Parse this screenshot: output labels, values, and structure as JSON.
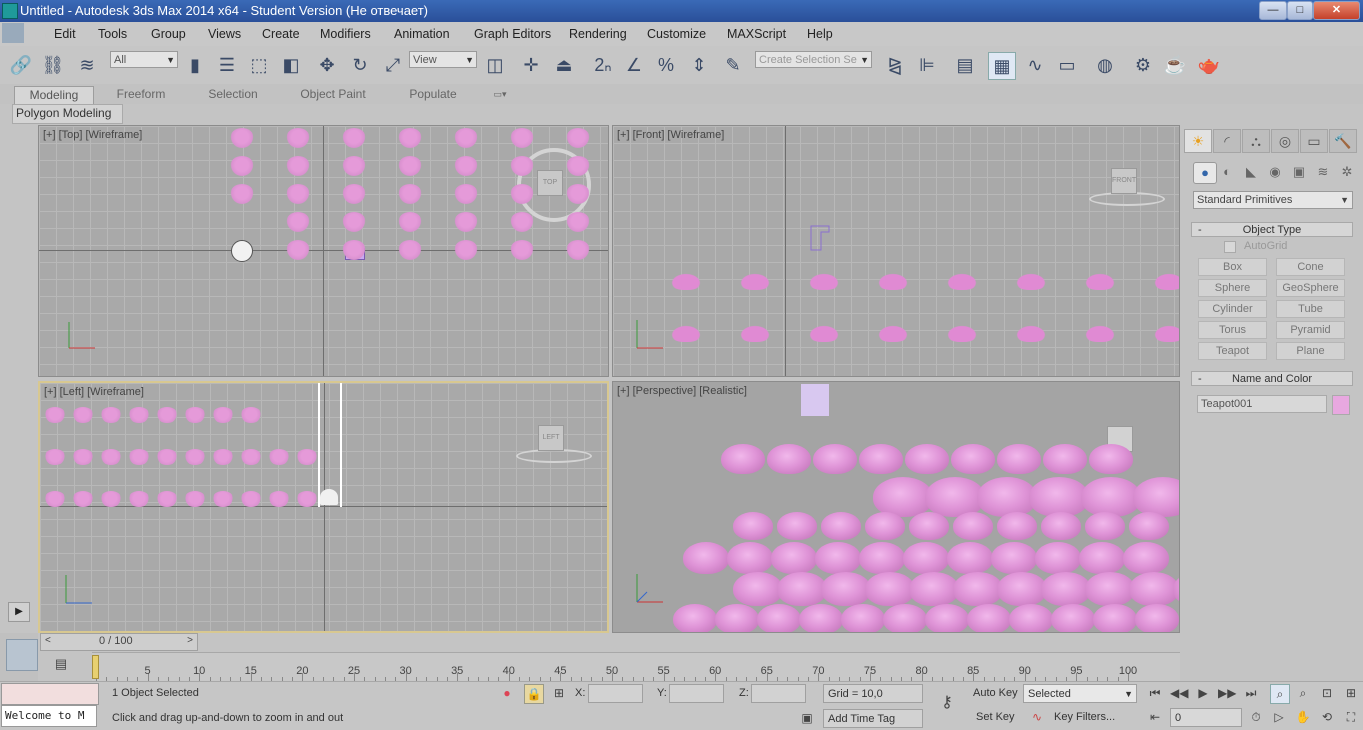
{
  "window": {
    "title": "Untitled - Autodesk 3ds Max  2014 x64  - Student Version (Не отвечает)",
    "controls": {
      "minimize": "—",
      "maximize": "□",
      "close": "✕"
    }
  },
  "menu": [
    "Edit",
    "Tools",
    "Group",
    "Views",
    "Create",
    "Modifiers",
    "Animation",
    "Graph Editors",
    "Rendering",
    "Customize",
    "MAXScript",
    "Help"
  ],
  "toolbar": {
    "filter_value": "All",
    "ref_coord_value": "View",
    "selection_set_placeholder": "Create Selection Se",
    "icons": [
      "link-icon",
      "unlink-icon",
      "bind-spacewarp-icon",
      "select-object-icon",
      "select-by-name-icon",
      "rect-selection-icon",
      "window-crossing-icon",
      "move-icon",
      "rotate-icon",
      "scale-icon",
      "snap-2d-icon",
      "angle-snap-icon",
      "percent-snap-icon",
      "spinner-snap-icon",
      "edit-named-sets-icon",
      "mirror-icon",
      "align-icon",
      "layer-manager-icon",
      "graphite-toggle-icon",
      "curve-editor-icon",
      "schematic-view-icon",
      "material-editor-icon",
      "render-setup-icon",
      "rendered-frame-icon",
      "render-icon"
    ]
  },
  "ribbon": {
    "tabs": [
      "Modeling",
      "Freeform",
      "Selection",
      "Object Paint",
      "Populate"
    ],
    "active_tab": "Modeling",
    "sub_label": "Polygon Modeling"
  },
  "viewports": {
    "top": "[+] [Top] [Wireframe]",
    "front": "[+] [Front] [Wireframe]",
    "left": "[+] [Left] [Wireframe]",
    "perspective": "[+] [Perspective] [Realistic]",
    "cube_labels": {
      "top": "TOP",
      "front": "FRONT",
      "left": "LEFT"
    }
  },
  "command_panel": {
    "tabs": [
      "create-tab",
      "modify-tab",
      "hierarchy-tab",
      "motion-tab",
      "display-tab",
      "utilities-tab"
    ],
    "subcategories": [
      "geometry-icon",
      "shapes-icon",
      "lights-icon",
      "cameras-icon",
      "helpers-icon",
      "spacewarps-icon",
      "systems-icon"
    ],
    "category": "Standard Primitives",
    "object_type_header": "Object Type",
    "autogrid_label": "AutoGrid",
    "primitives": [
      "Box",
      "Cone",
      "Sphere",
      "GeoSphere",
      "Cylinder",
      "Tube",
      "Torus",
      "Pyramid",
      "Teapot",
      "Plane"
    ],
    "name_color_header": "Name and Color",
    "object_name": "Teapot001",
    "object_color": "#e8a8e0",
    "rollout_minus": "-"
  },
  "timeline": {
    "slider_label": "0 / 100",
    "ticks": [
      5,
      10,
      15,
      20,
      25,
      30,
      35,
      40,
      45,
      50,
      55,
      60,
      65,
      70,
      75,
      80,
      85,
      90,
      95,
      100
    ]
  },
  "status": {
    "selected": "1 Object Selected",
    "prompt": "Click and drag up-and-down to zoom in and out",
    "listener": "Welcome to M",
    "x_label": "X:",
    "y_label": "Y:",
    "z_label": "Z:",
    "grid": "Grid = 10,0",
    "add_time_tag": "Add Time Tag",
    "auto_key": "Auto Key",
    "set_key": "Set Key",
    "key_mode_value": "Selected",
    "key_filters": "Key Filters...",
    "frame_value": "0"
  },
  "colors": {
    "accent": "#e59ad9",
    "title_bar": "#2a4f99",
    "active_viewport_border": "#d8c890"
  }
}
